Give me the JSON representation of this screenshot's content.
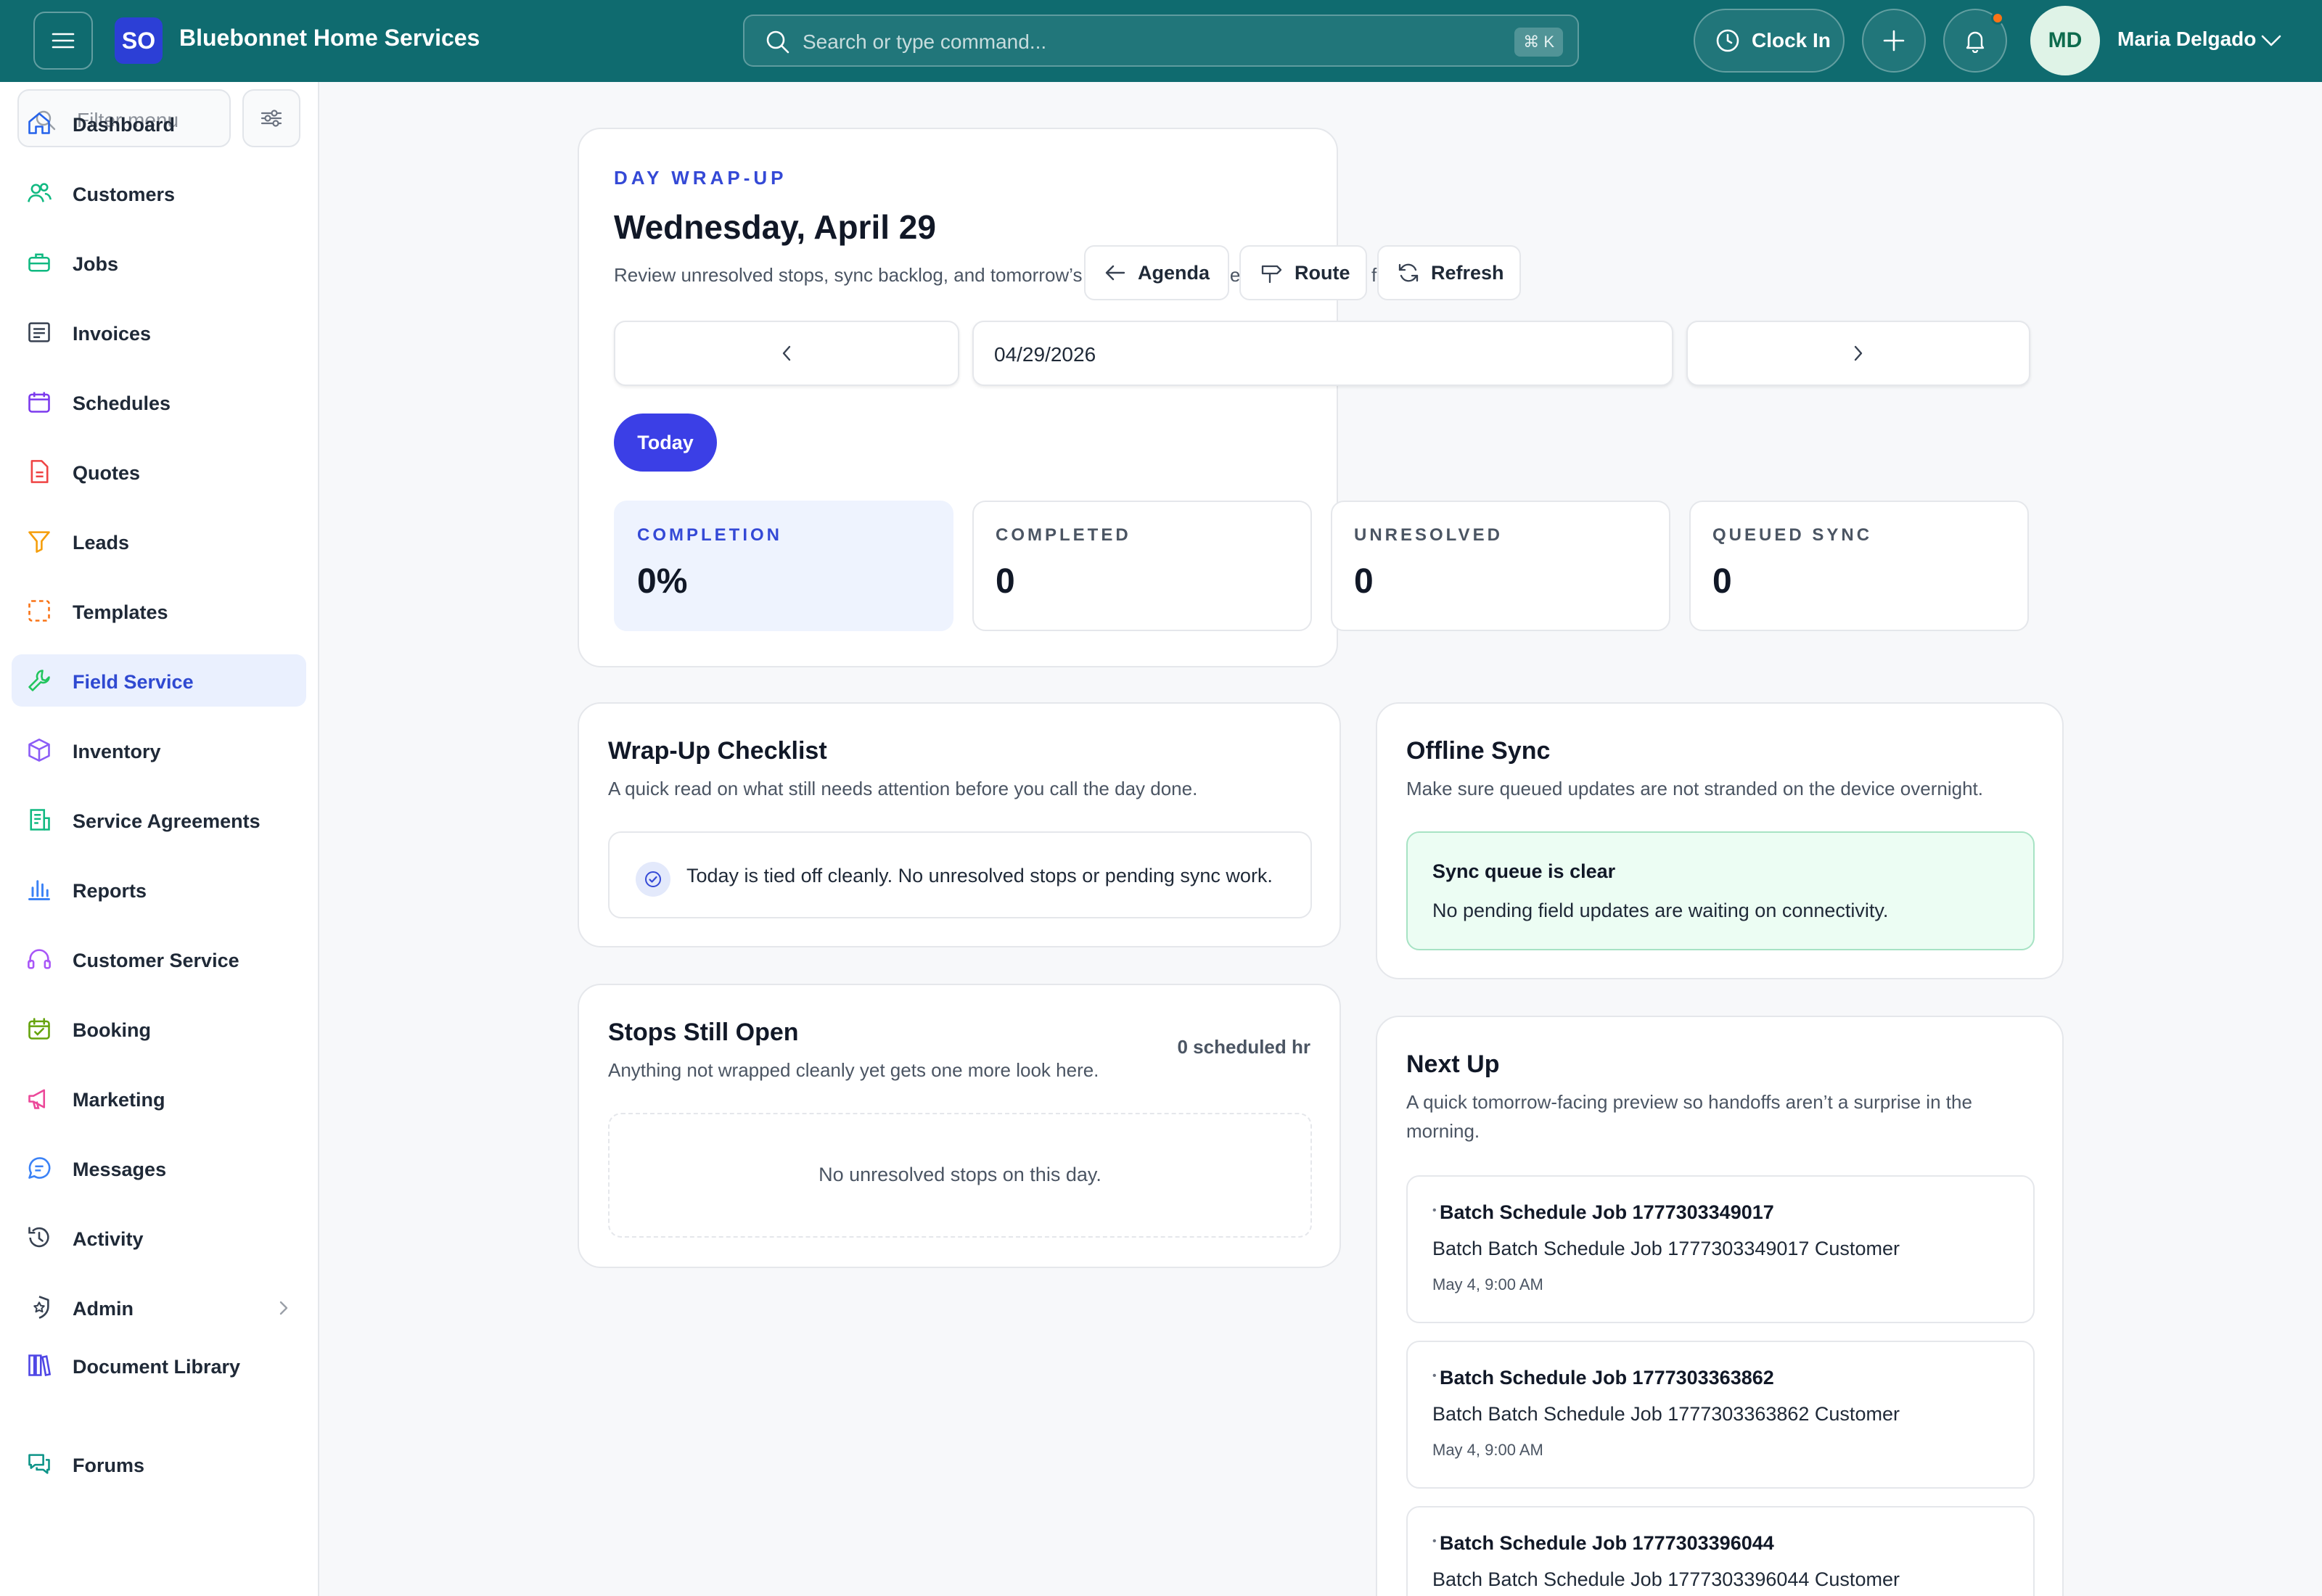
{
  "topbar": {
    "logo_initials": "SO",
    "brand": "Bluebonnet Home Services",
    "search_placeholder": "Search or type command...",
    "search_shortcut": "⌘ K",
    "clock_in_label": "Clock In",
    "user_initials": "MD",
    "user_name": "Maria Delgado"
  },
  "sidebar": {
    "filter_placeholder": "Filter menu",
    "items": [
      {
        "label": "Dashboard",
        "icon": "home-icon",
        "color": "#2563eb"
      },
      {
        "label": "Customers",
        "icon": "users-icon",
        "color": "#10b981"
      },
      {
        "label": "Jobs",
        "icon": "briefcase-icon",
        "color": "#10b981"
      },
      {
        "label": "Invoices",
        "icon": "invoice-icon",
        "color": "#374151"
      },
      {
        "label": "Schedules",
        "icon": "calendar-icon",
        "color": "#7c3aed"
      },
      {
        "label": "Quotes",
        "icon": "document-icon",
        "color": "#ef4444"
      },
      {
        "label": "Leads",
        "icon": "funnel-icon",
        "color": "#f59e0b"
      },
      {
        "label": "Templates",
        "icon": "template-icon",
        "color": "#f97316"
      },
      {
        "label": "Field Service",
        "icon": "wrench-icon",
        "color": "#22c55e",
        "active": true
      },
      {
        "label": "Inventory",
        "icon": "box-icon",
        "color": "#8b5cf6"
      },
      {
        "label": "Service Agreements",
        "icon": "agreement-icon",
        "color": "#10b981"
      },
      {
        "label": "Reports",
        "icon": "bar-chart-icon",
        "color": "#3b82f6"
      },
      {
        "label": "Customer Service",
        "icon": "headset-icon",
        "color": "#a855f7"
      },
      {
        "label": "Booking",
        "icon": "calendar-check-icon",
        "color": "#65a30d"
      },
      {
        "label": "Marketing",
        "icon": "megaphone-icon",
        "color": "#ec4899"
      },
      {
        "label": "Messages",
        "icon": "chat-icon",
        "color": "#3b82f6"
      },
      {
        "label": "Activity",
        "icon": "history-icon",
        "color": "#374151"
      },
      {
        "label": "Admin",
        "icon": "shield-star-icon",
        "color": "#374151"
      },
      {
        "label": "Document Library",
        "icon": "library-icon",
        "color": "#4f46e5"
      },
      {
        "label": "Forums",
        "icon": "forum-icon",
        "color": "#0d9488"
      }
    ]
  },
  "wrapup": {
    "eyebrow": "DAY WRAP-UP",
    "title": "Wednesday, April 29",
    "subtitle": "Review unresolved stops, sync backlog, and tomorrow’s handoff before the day gets away from you.",
    "agenda_label": "Agenda",
    "route_label": "Route",
    "refresh_label": "Refresh",
    "date_value": "04/29/2026",
    "today_label": "Today",
    "stats": [
      {
        "label": "COMPLETION",
        "value": "0%"
      },
      {
        "label": "COMPLETED",
        "value": "0"
      },
      {
        "label": "UNRESOLVED",
        "value": "0"
      },
      {
        "label": "QUEUED SYNC",
        "value": "0"
      }
    ]
  },
  "checklist": {
    "title": "Wrap-Up Checklist",
    "subtitle": "A quick read on what still needs attention before you call the day done.",
    "message": "Today is tied off cleanly. No unresolved stops or pending sync work."
  },
  "offline_sync": {
    "title": "Offline Sync",
    "subtitle": "Make sure queued updates are not stranded on the device overnight.",
    "status_title": "Sync queue is clear",
    "status_text": "No pending field updates are waiting on connectivity."
  },
  "stops_open": {
    "title": "Stops Still Open",
    "subtitle": "Anything not wrapped cleanly yet gets one more look here.",
    "scheduled_hours": "0 scheduled hr",
    "empty_text": "No unresolved stops on this day."
  },
  "next_up": {
    "title": "Next Up",
    "subtitle_line1": "A quick tomorrow-facing preview so handoffs aren’t a surprise in the",
    "subtitle_line2": "morning.",
    "jobs": [
      {
        "title": "Batch Schedule Job 1777303349017",
        "customer": "Batch Batch Schedule Job 1777303349017 Customer",
        "time": "May 4, 9:00 AM"
      },
      {
        "title": "Batch Schedule Job 1777303363862",
        "customer": "Batch Batch Schedule Job 1777303363862 Customer",
        "time": "May 4, 9:00 AM"
      },
      {
        "title": "Batch Schedule Job 1777303396044",
        "customer": "Batch Batch Schedule Job 1777303396044 Customer",
        "time": ""
      }
    ]
  },
  "colors": {
    "topbar": "#0f6b6f",
    "accent": "#3b3fe6",
    "active_nav_bg": "#eaf0fe"
  }
}
